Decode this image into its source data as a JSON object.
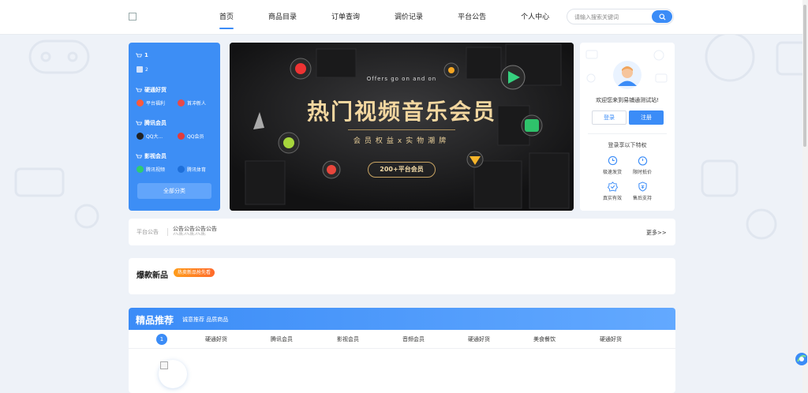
{
  "header": {
    "nav": [
      "首页",
      "商品目录",
      "订单查询",
      "调价记录",
      "平台公告",
      "个人中心"
    ],
    "active_index": 0,
    "search_placeholder": "请输入搜索关键词"
  },
  "category_panel": {
    "groups": [
      {
        "title": "1",
        "items": [
          {
            "label": "2"
          }
        ]
      },
      {
        "title": "硬通好货",
        "items": [
          {
            "label": "平台福利",
            "color": "#ff5a3c"
          },
          {
            "label": "首冲新人",
            "color": "#e84a4a"
          }
        ]
      },
      {
        "title": "腾讯会员",
        "items": [
          {
            "label": "QQ大...",
            "color": "#222222"
          },
          {
            "label": "QQ会员",
            "color": "#e23b3b"
          }
        ]
      },
      {
        "title": "影视会员",
        "items": [
          {
            "label": "腾讯视频",
            "color": "#2ecc71"
          },
          {
            "label": "腾讯体育",
            "color": "#1e6fd9"
          }
        ]
      }
    ],
    "all_button": "全部分类"
  },
  "banner": {
    "subtitle": "Offers go on and on",
    "title": "热门视频音乐会员",
    "tagline": "会员权益x实物潮牌",
    "pill": "200+平台会员"
  },
  "user_card": {
    "welcome": "欢迎您来到易铺通测试站!",
    "login": "登录",
    "register": "注册",
    "privileges_title": "登录享以下特权",
    "privileges": [
      {
        "label": "极速发货",
        "icon": "clock-fast-icon"
      },
      {
        "label": "限时抵价",
        "icon": "timer-icon"
      },
      {
        "label": "真实有效",
        "icon": "verified-icon"
      },
      {
        "label": "售后支持",
        "icon": "shield-icon"
      }
    ]
  },
  "notice": {
    "label": "平台公告",
    "text": "公告公告公告公告",
    "text2": "公告公告公告",
    "more": "更多>>"
  },
  "hot": {
    "title": "爆款新品",
    "badge": "热卖新品抢先看"
  },
  "recommend": {
    "title": "精品推荐",
    "subtitle": "诚意推荐 品质商品",
    "active_tab": "1",
    "tabs": [
      "硬通好货",
      "腾讯会员",
      "影视会员",
      "音频会员",
      "硬通好货",
      "美食餐饮",
      "硬通好货"
    ]
  },
  "colors": {
    "accent": "#3b8cf7",
    "background": "#eef2f8",
    "banner_gold": "#f3d7a0"
  }
}
